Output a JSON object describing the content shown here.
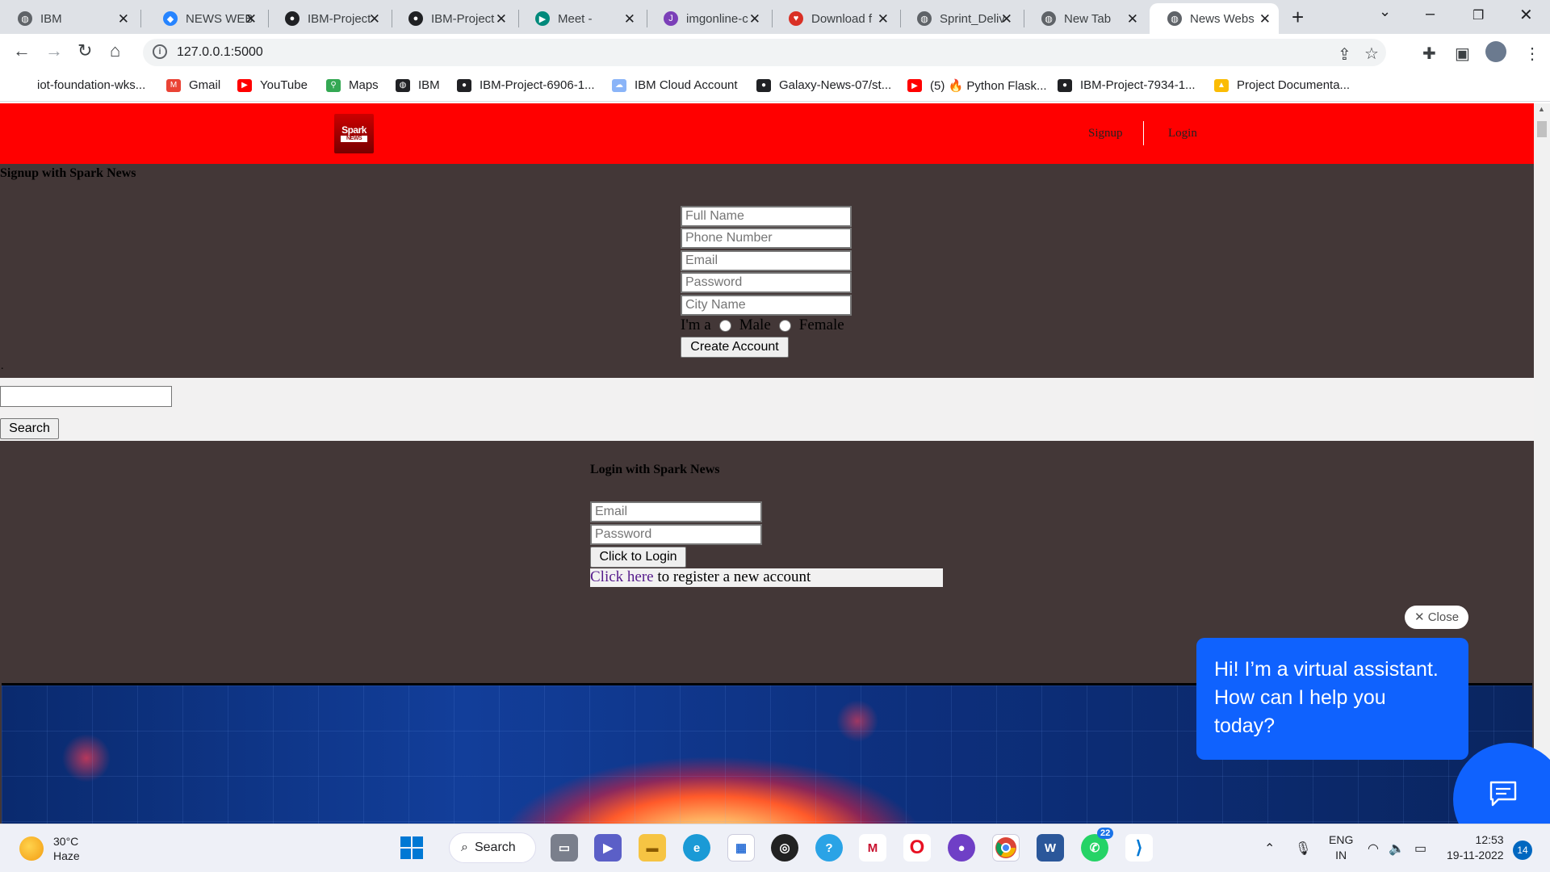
{
  "browser": {
    "tabs": [
      {
        "title": "IBM",
        "favicon": "globe-icon",
        "color": "#5f6368"
      },
      {
        "title": "NEWS WEB",
        "favicon": "jira-icon",
        "color": "#2684ff"
      },
      {
        "title": "IBM-Project",
        "favicon": "github-icon",
        "color": "#202124"
      },
      {
        "title": "IBM-Project",
        "favicon": "github-icon",
        "color": "#202124"
      },
      {
        "title": "Meet -",
        "favicon": "meet-icon",
        "color": "#00897b"
      },
      {
        "title": "imgonline-c",
        "favicon": "jpg-icon",
        "color": "#7b3fb8"
      },
      {
        "title": "Download f",
        "favicon": "heart-icon",
        "color": "#d93025"
      },
      {
        "title": "Sprint_Deliv",
        "favicon": "globe-icon",
        "color": "#5f6368"
      },
      {
        "title": "New Tab",
        "favicon": "chrome-icon",
        "color": "#5f6368"
      },
      {
        "title": "News Webs",
        "favicon": "globe-icon",
        "color": "#5f6368",
        "active": true
      }
    ],
    "url": "127.0.0.1:5000",
    "bookmarks": [
      {
        "label": "iot-foundation-wks...",
        "icon": "none"
      },
      {
        "label": "Gmail",
        "icon": "gmail-icon",
        "color": "#ea4335"
      },
      {
        "label": "YouTube",
        "icon": "youtube-icon",
        "color": "#ff0000"
      },
      {
        "label": "Maps",
        "icon": "maps-icon",
        "color": "#34a853"
      },
      {
        "label": "IBM",
        "icon": "globe-icon",
        "color": "#202124"
      },
      {
        "label": "IBM-Project-6906-1...",
        "icon": "github-icon",
        "color": "#202124"
      },
      {
        "label": "IBM Cloud Account",
        "icon": "cloud-icon",
        "color": "#8ab4f8"
      },
      {
        "label": "Galaxy-News-07/st...",
        "icon": "github-icon",
        "color": "#202124"
      },
      {
        "label": "(5) 🔥 Python Flask...",
        "icon": "youtube-icon",
        "color": "#ff0000"
      },
      {
        "label": "IBM-Project-7934-1...",
        "icon": "github-icon",
        "color": "#202124"
      },
      {
        "label": "Project Documenta...",
        "icon": "drive-icon",
        "color": "#fbbc04"
      }
    ]
  },
  "site": {
    "logo_text": "Spark",
    "logo_sub": "NEWS",
    "nav": {
      "signup": "Signup",
      "login": "Login"
    }
  },
  "signup": {
    "title": "Signup with Spark News",
    "full_name_placeholder": "Full Name",
    "phone_placeholder": "Phone Number",
    "email_placeholder": "Email",
    "password_placeholder": "Password",
    "city_placeholder": "City Name",
    "gender_prefix": "I'm a",
    "male_label": "Male",
    "female_label": "Female",
    "submit_label": "Create Account"
  },
  "search": {
    "button_label": "Search",
    "dot": "."
  },
  "login": {
    "title": "Login with Spark News",
    "email_placeholder": "Email",
    "password_placeholder": "Password",
    "submit_label": "Click to Login",
    "register_link": "Click here",
    "register_text": " to register a new account"
  },
  "chat": {
    "close_label": "Close",
    "message": "Hi! I’m a virtual assistant. How can I help you today?"
  },
  "taskbar": {
    "temperature": "30°C",
    "weather": "Haze",
    "search_label": "Search",
    "whatsapp_badge": "22",
    "language": "ENG",
    "region": "IN",
    "time": "12:53",
    "date": "19-11-2022",
    "notifications": "14"
  }
}
